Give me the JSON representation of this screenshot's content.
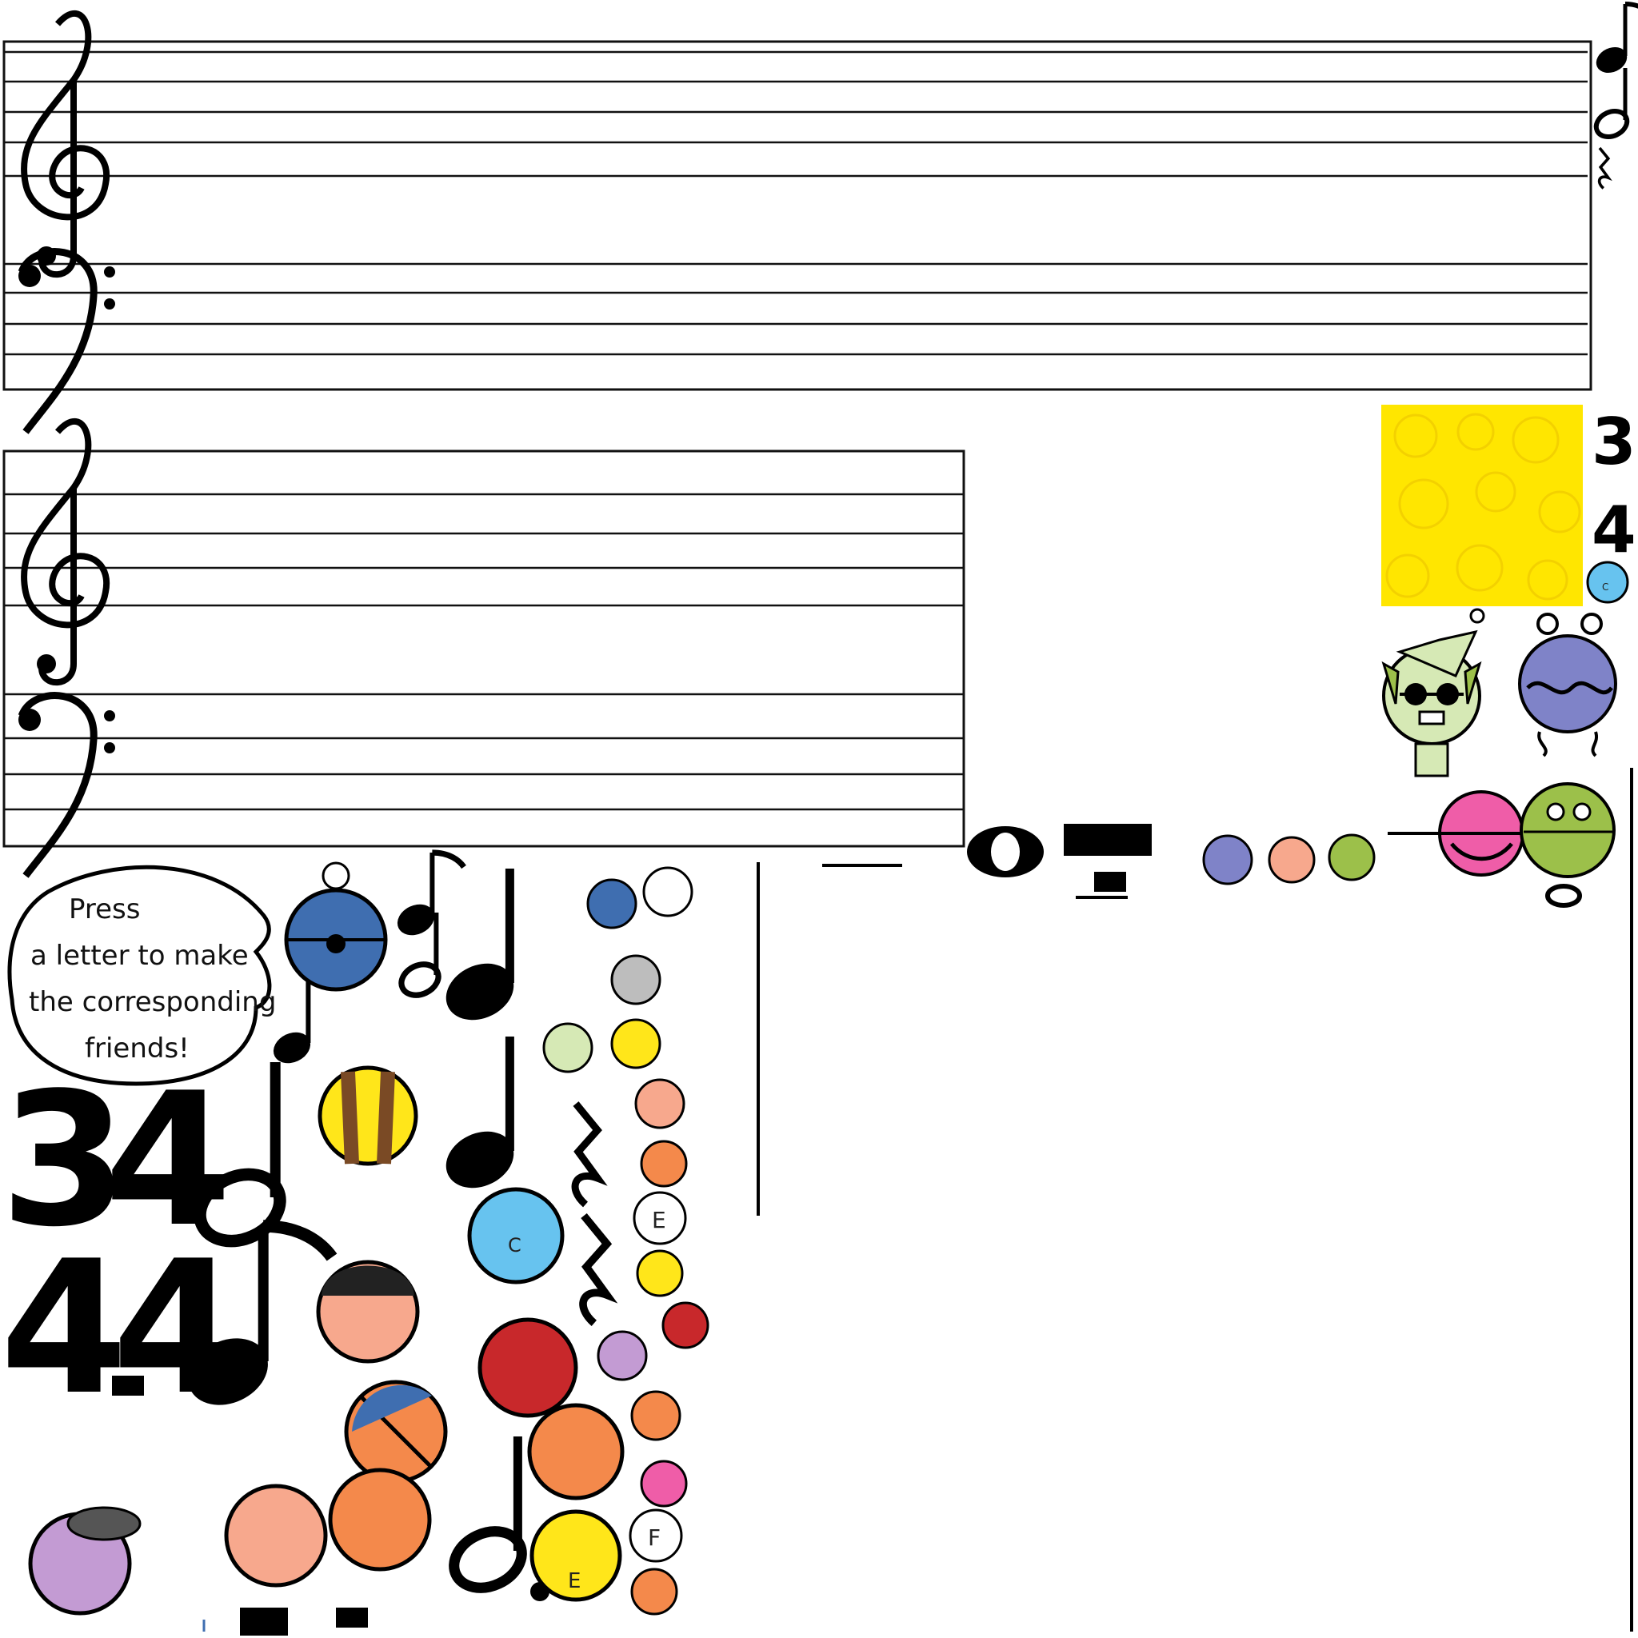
{
  "speech_bubble": {
    "lines": [
      "Press",
      "a letter to make",
      "the corresponding",
      "friends!"
    ]
  },
  "time_signatures": {
    "small_top": "3",
    "small_bottom": "4",
    "large_top": "3",
    "large_bottom": "4",
    "mid_top": "4",
    "mid_bottom": "4"
  },
  "letters": {
    "white_face_e": "E",
    "white_face_f": "F",
    "yellow_face_e": "E",
    "blue_face_c": "C"
  },
  "icons": [
    "treble-clef-icon",
    "bass-clef-icon",
    "quarter-note-icon",
    "eighth-note-icon",
    "dotted-half-note-icon",
    "quarter-rest-icon",
    "eighth-rest-icon",
    "whole-note-icon",
    "half-rest-icon",
    "whole-rest-icon",
    "star-face-icon",
    "bee-character-icon",
    "alien-character-icon",
    "monster-character-icon"
  ],
  "colors": {
    "staff_line": "#111111",
    "yellow_tile": "#ffe600",
    "blue_character": "#3f6eb0",
    "orange_character": "#f4894b",
    "red_character": "#c8282b",
    "pink_character": "#ef5da8",
    "purple_character": "#c39bd3",
    "green_character": "#9cc04a",
    "light_blue_character": "#67c3ef",
    "lavender_monster": "#7f83c8",
    "alien_green": "#d6e9b5",
    "yellow_smiley": "#ffe61a"
  }
}
